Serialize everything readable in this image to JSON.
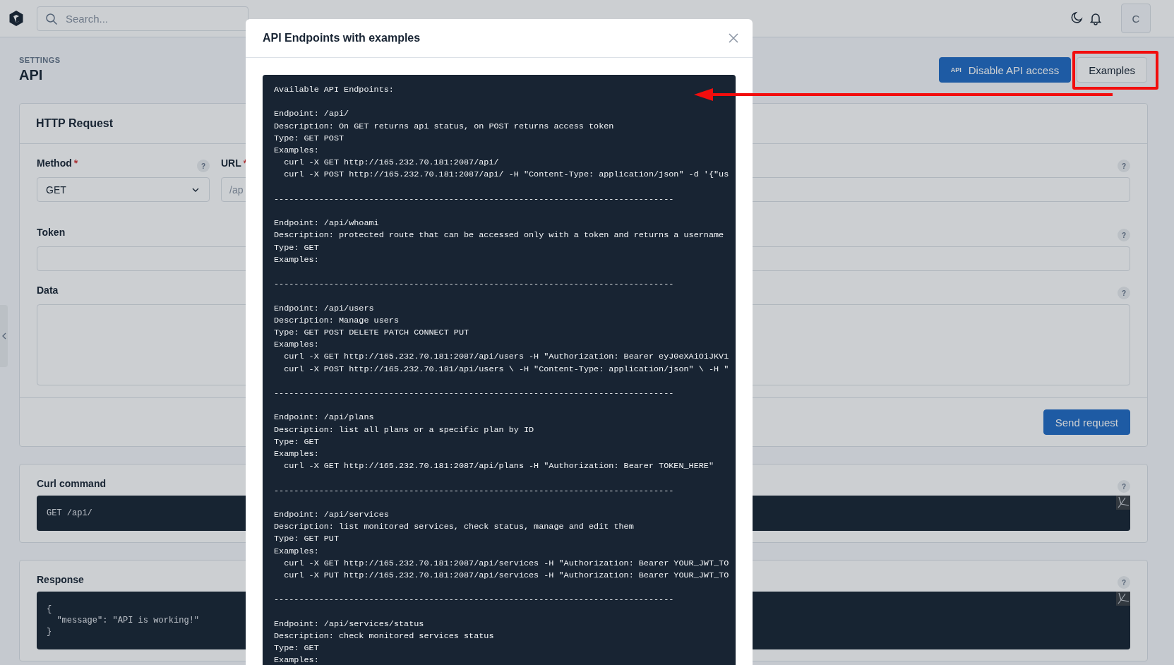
{
  "topbar": {
    "search": {
      "placeholder": "Search..."
    },
    "avatar": "C"
  },
  "page": {
    "eyebrow": "SETTINGS",
    "title": "API",
    "actions": [
      {
        "kind": "primary",
        "icon_text": "API",
        "label": "Disable API access"
      },
      {
        "kind": "secondary",
        "label": "Examples"
      }
    ]
  },
  "request_card": {
    "title": "HTTP Request",
    "fields": [
      {
        "kind": "select",
        "label": "Method",
        "marker": "*",
        "help": "?",
        "value": "GET"
      },
      {
        "kind": "text",
        "label": "URL",
        "marker": "*",
        "help": "?",
        "value": "/ap"
      },
      {
        "kind": "text",
        "label": "Token",
        "help": "?"
      },
      {
        "kind": "textarea",
        "label": "Data",
        "help": "?"
      }
    ],
    "submit": "Send request"
  },
  "curl_card": {
    "title": "Curl command",
    "help": "?",
    "code": [
      "GET /api/"
    ]
  },
  "response_card": {
    "title": "Response",
    "help": "?",
    "code": [
      "{",
      "  \"message\": \"API is working!\"",
      "}"
    ]
  },
  "modal": {
    "title": "API Endpoints with examples",
    "code": {
      "heading": "Available API Endpoints:",
      "sections": [
        {
          "endpoint": "Endpoint: /api/",
          "description": "Description: On GET returns api status, on POST returns access token",
          "type": "Type: GET POST",
          "examples_label": "Examples:",
          "examples": [
            "  curl -X GET http://165.232.70.181:2087/api/",
            "  curl -X POST http://165.232.70.181:2087/api/ -H \"Content-Type: application/json\" -d '{\"us"
          ],
          "separator": "--------------------------------------------------------------------------------"
        },
        {
          "endpoint": "Endpoint: /api/whoami",
          "description": "Description: protected route that can be accessed only with a token and returns a username",
          "type": "Type: GET",
          "examples_label": "Examples:",
          "separator": "--------------------------------------------------------------------------------"
        },
        {
          "endpoint": "Endpoint: /api/users",
          "description": "Description: Manage users",
          "type": "Type: GET POST DELETE PATCH CONNECT PUT",
          "examples_label": "Examples:",
          "examples": [
            "  curl -X GET http://165.232.70.181:2087/api/users -H \"Authorization: Bearer eyJ0eXAiOiJKV1",
            "  curl -X POST http://165.232.70.181/api/users \\ -H \"Content-Type: application/json\" \\ -H \""
          ],
          "separator": "--------------------------------------------------------------------------------"
        },
        {
          "endpoint": "Endpoint: /api/plans",
          "description": "Description: list all plans or a specific plan by ID",
          "type": "Type: GET",
          "examples_label": "Examples:",
          "examples": [
            "  curl -X GET http://165.232.70.181:2087/api/plans -H \"Authorization: Bearer TOKEN_HERE\""
          ],
          "separator": "--------------------------------------------------------------------------------"
        },
        {
          "endpoint": "Endpoint: /api/services",
          "description": "Description: list monitored services, check status, manage and edit them",
          "type": "Type: GET PUT",
          "examples_label": "Examples:",
          "examples": [
            "  curl -X GET http://165.232.70.181:2087/api/services -H \"Authorization: Bearer YOUR_JWT_TO",
            "  curl -X PUT http://165.232.70.181:2087/api/services -H \"Authorization: Bearer YOUR_JWT_TO"
          ],
          "separator": "--------------------------------------------------------------------------------"
        },
        {
          "endpoint": "Endpoint: /api/services/status",
          "description": "Description: check monitored services status",
          "type": "Type: GET",
          "examples_label": "Examples:"
        }
      ]
    }
  }
}
